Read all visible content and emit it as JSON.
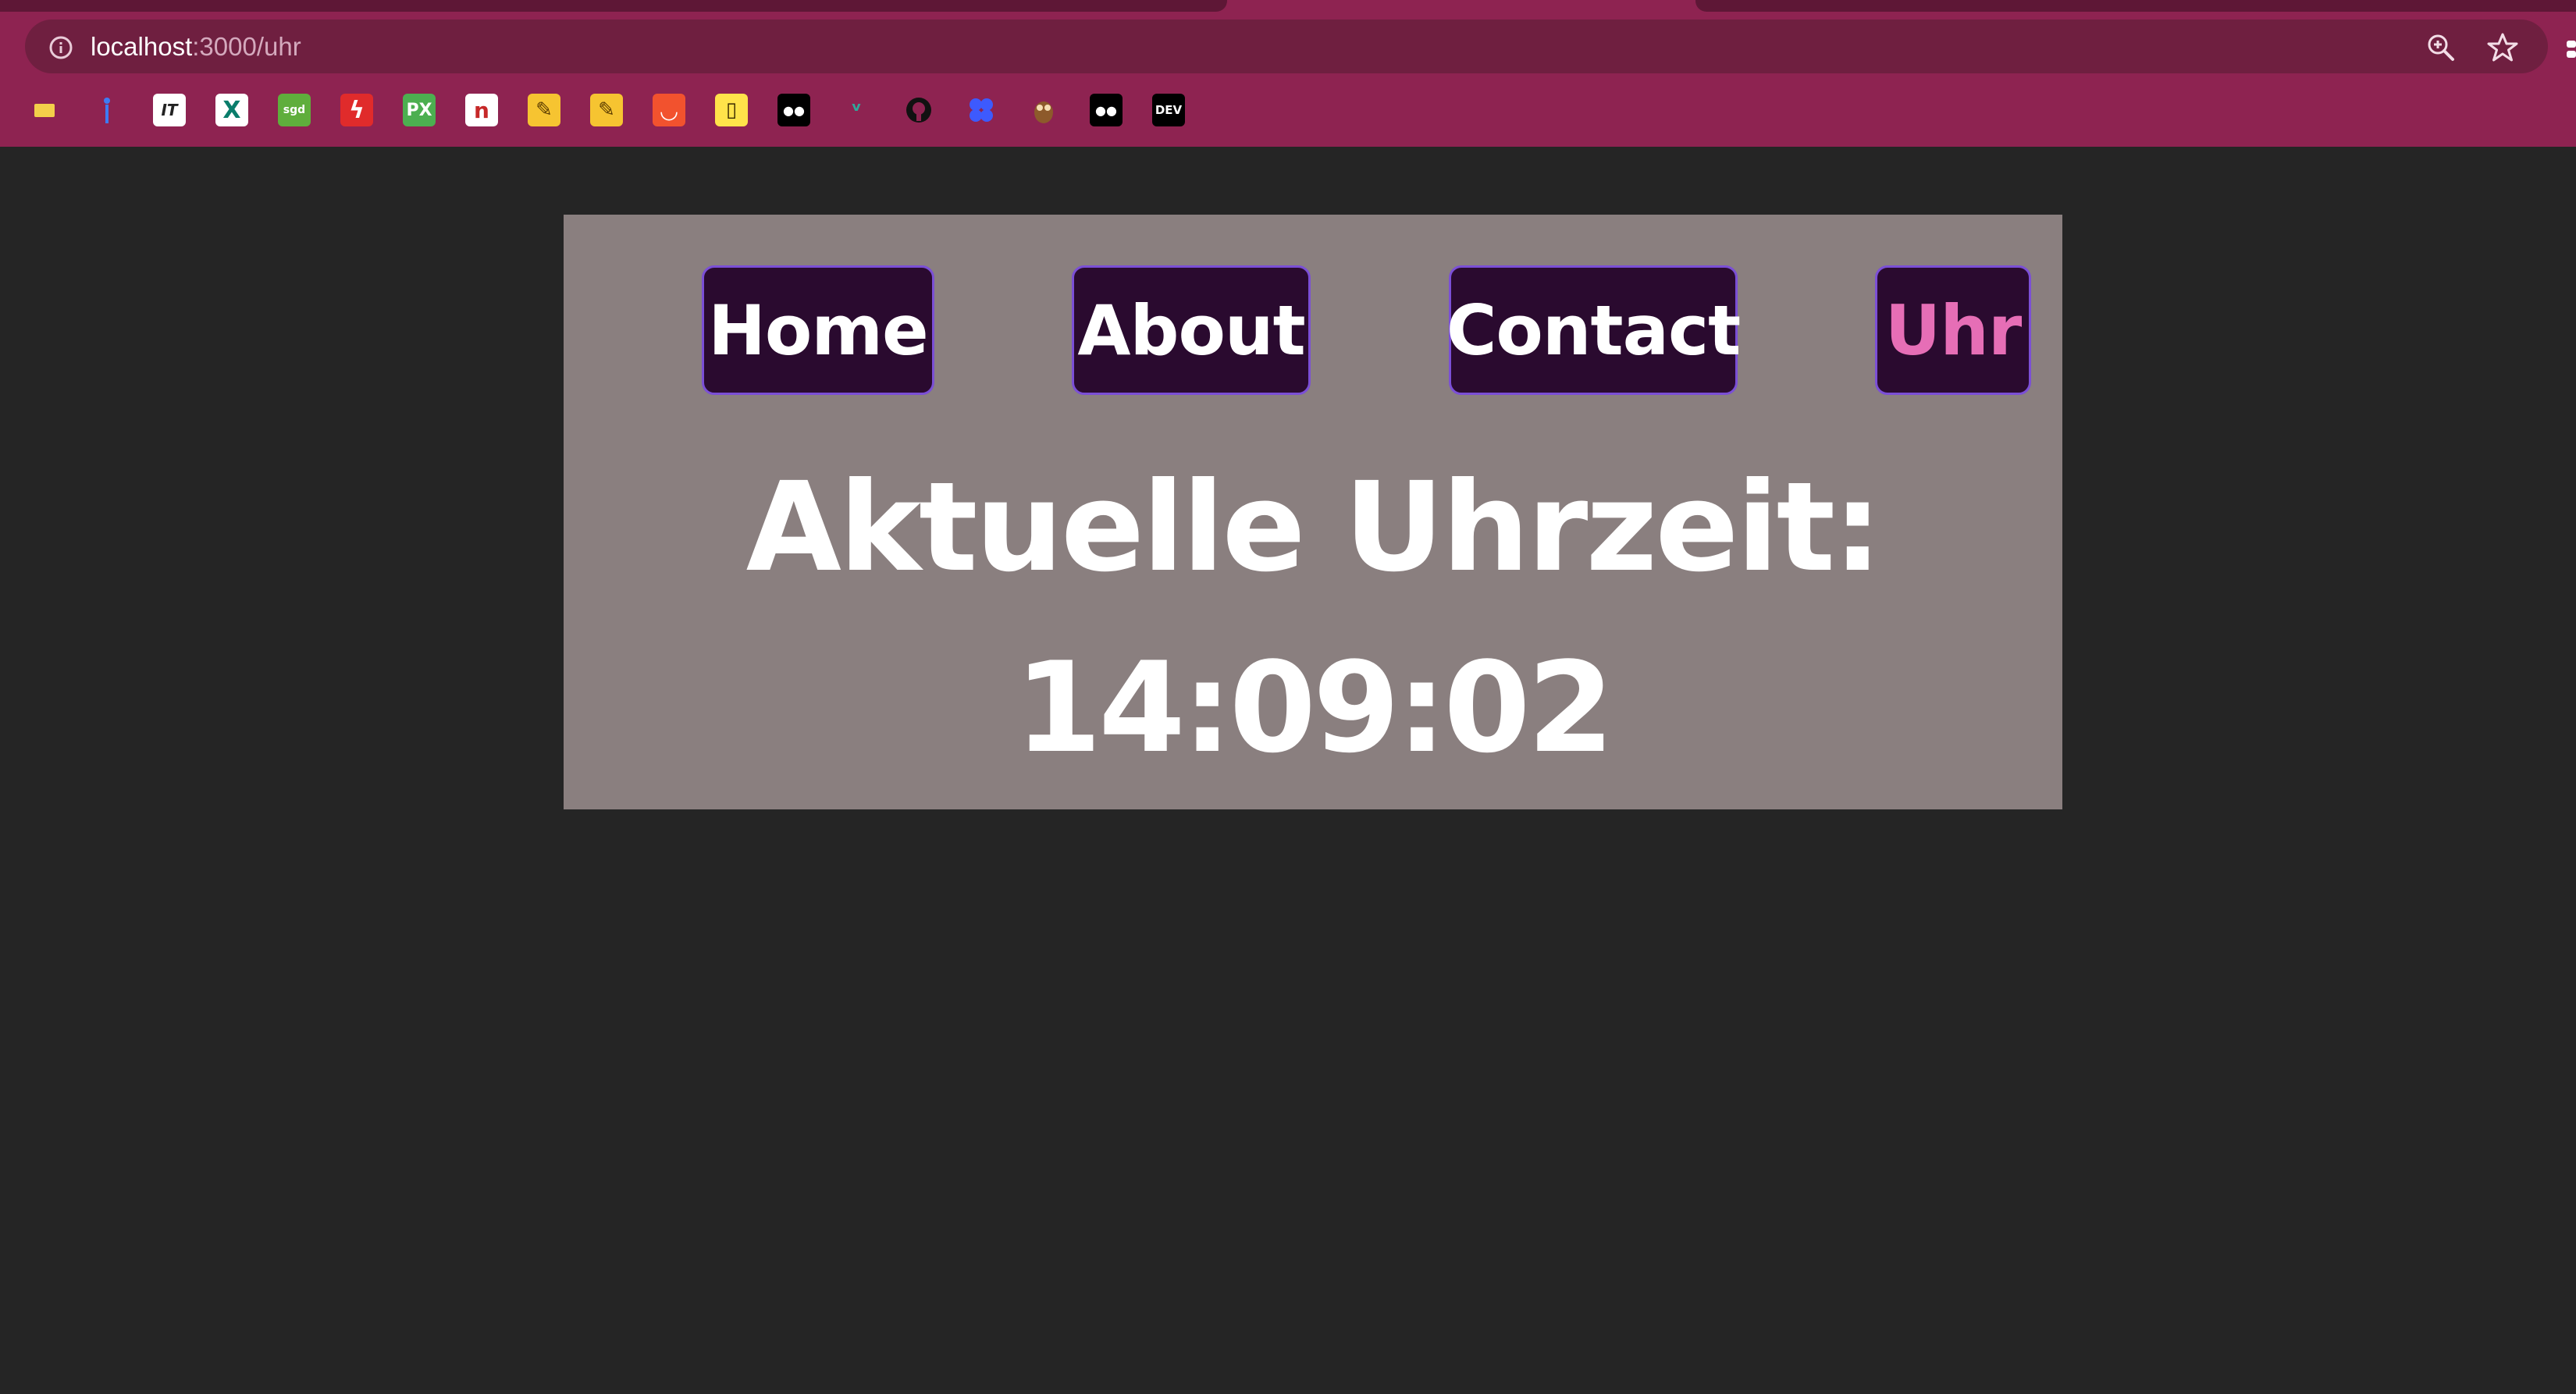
{
  "browser": {
    "url_host": "localhost",
    "url_path": ":3000/uhr",
    "theme_color": "#8e2351",
    "icons": [
      "info-icon",
      "zoom-icon",
      "bookmark-star-icon"
    ]
  },
  "bookmarks": [
    {
      "name": "folder-bookmark",
      "text": ""
    },
    {
      "name": "pin-bookmark",
      "text": ""
    },
    {
      "name": "it-bookmark",
      "text": "IT"
    },
    {
      "name": "xing-bookmark",
      "text": "X"
    },
    {
      "name": "sgd-bookmark",
      "text": "sgd"
    },
    {
      "name": "flash-bookmark",
      "text": "ϟ"
    },
    {
      "name": "px-bookmark",
      "text": "PX"
    },
    {
      "name": "n-bookmark",
      "text": "n"
    },
    {
      "name": "tool-bookmark-1",
      "text": "✎"
    },
    {
      "name": "tool-bookmark-2",
      "text": "✎"
    },
    {
      "name": "shopping-bag-bookmark",
      "text": "◡"
    },
    {
      "name": "cup-bookmark",
      "text": "▯"
    },
    {
      "name": "medium-bookmark",
      "text": "●●"
    },
    {
      "name": "bird-bookmark",
      "text": "ᵛ"
    },
    {
      "name": "github-bookmark",
      "text": ""
    },
    {
      "name": "puzzle-bookmark",
      "text": ""
    },
    {
      "name": "owl-bookmark",
      "text": ""
    },
    {
      "name": "medium-bookmark-2",
      "text": "●●"
    },
    {
      "name": "dev-bookmark",
      "text": "DEV"
    }
  ],
  "nav": {
    "home": "Home",
    "about": "About",
    "contact": "Contact",
    "uhr": "Uhr",
    "active": "uhr"
  },
  "main": {
    "heading": "Aktuelle Uhrzeit:",
    "time": "14:09:02"
  },
  "colors": {
    "page_background": "#252525",
    "card_background": "#8a7f7f",
    "button_background": "#2a0a2f",
    "button_border": "#7b4fd6",
    "active_text": "#e66eb6"
  }
}
